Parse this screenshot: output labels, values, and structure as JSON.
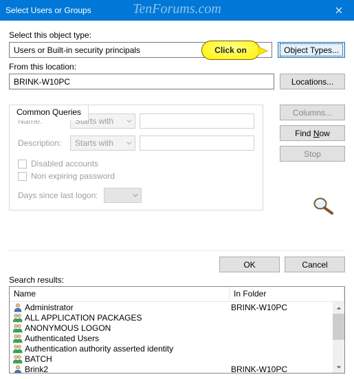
{
  "window": {
    "title": "Select Users or Groups",
    "watermark": "TenForums.com"
  },
  "callout": {
    "text": "Click on"
  },
  "object_type": {
    "label": "Select this object type:",
    "value": "Users or Built-in security principals",
    "button": "Object Types..."
  },
  "location": {
    "label": "From this location:",
    "value": "BRINK-W10PC",
    "button": "Locations..."
  },
  "tab": {
    "label": "Common Queries"
  },
  "queries": {
    "name_label": "Name:",
    "desc_label": "Description:",
    "starts_with": "Starts with",
    "disabled_accounts": "Disabled accounts",
    "non_expiring": "Non expiring password",
    "days_label": "Days since last logon:"
  },
  "side_buttons": {
    "columns": "Columns...",
    "find_now": "Find Now",
    "find_now_accel": "N",
    "stop": "Stop"
  },
  "okcancel": {
    "ok": "OK",
    "cancel": "Cancel"
  },
  "results": {
    "label": "Search results:",
    "col_name": "Name",
    "col_folder": "In Folder",
    "rows": [
      {
        "icon": "user",
        "name": "Administrator",
        "folder": "BRINK-W10PC"
      },
      {
        "icon": "group",
        "name": "ALL APPLICATION PACKAGES",
        "folder": ""
      },
      {
        "icon": "group",
        "name": "ANONYMOUS LOGON",
        "folder": ""
      },
      {
        "icon": "group",
        "name": "Authenticated Users",
        "folder": ""
      },
      {
        "icon": "group",
        "name": "Authentication authority asserted identity",
        "folder": ""
      },
      {
        "icon": "group",
        "name": "BATCH",
        "folder": ""
      },
      {
        "icon": "user",
        "name": "Brink2",
        "folder": "BRINK-W10PC"
      }
    ]
  }
}
